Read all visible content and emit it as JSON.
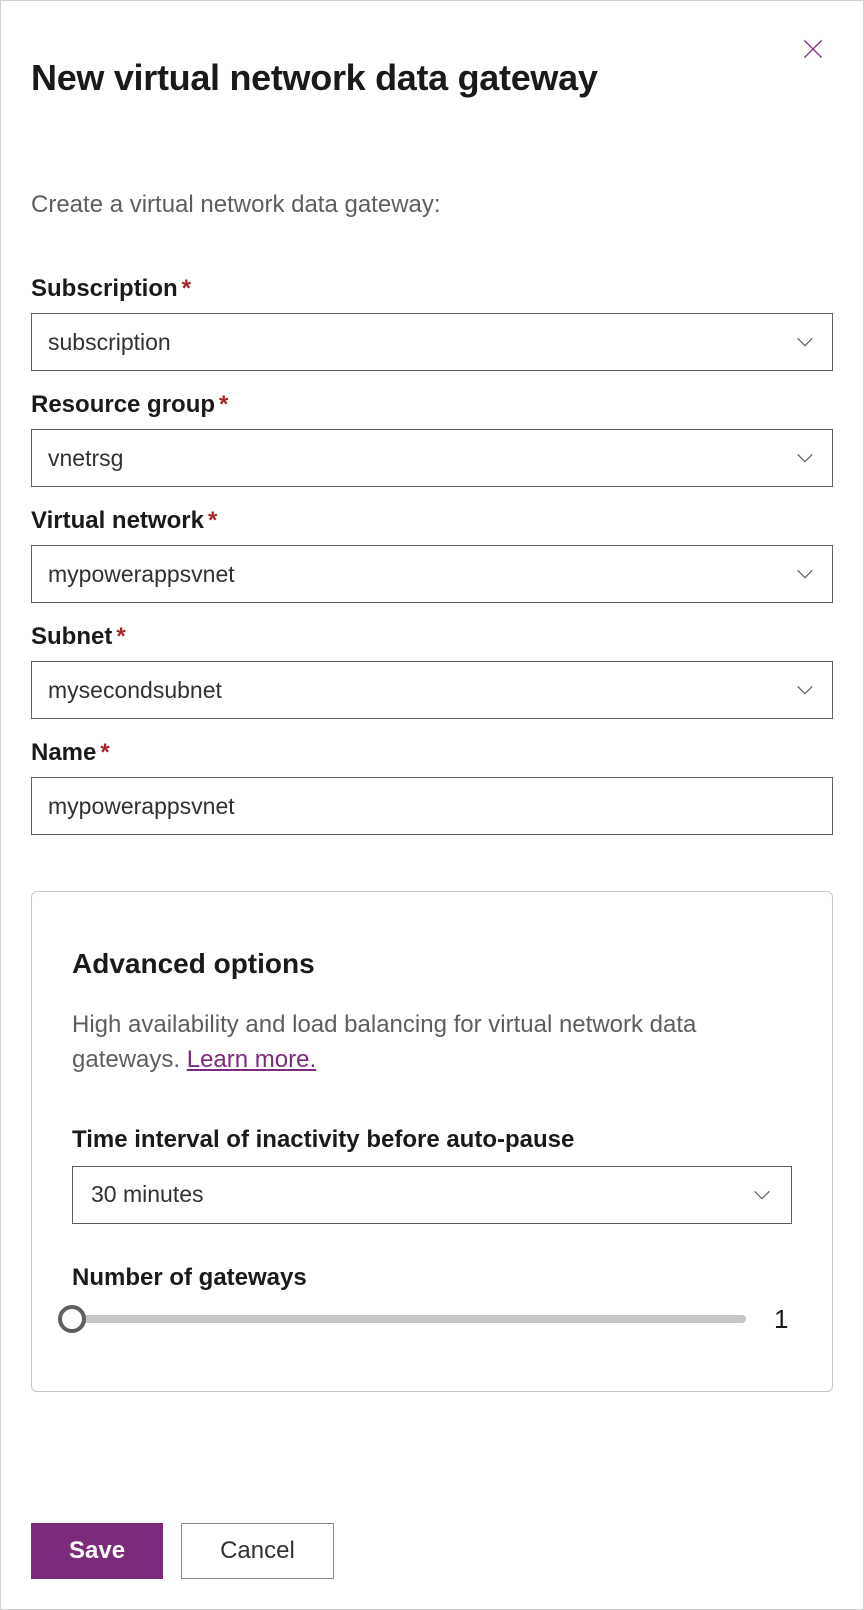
{
  "header": {
    "title": "New virtual network data gateway"
  },
  "subtitle": "Create a virtual network data gateway:",
  "fields": {
    "subscription": {
      "label": "Subscription",
      "value": "subscription"
    },
    "resource_group": {
      "label": "Resource group",
      "value": "vnetrsg"
    },
    "virtual_network": {
      "label": "Virtual network",
      "value": "mypowerappsvnet"
    },
    "subnet": {
      "label": "Subnet",
      "value": "mysecondsubnet"
    },
    "name": {
      "label": "Name",
      "value": "mypowerappsvnet"
    }
  },
  "advanced": {
    "title": "Advanced options",
    "description": "High availability and load balancing for virtual network data gateways. ",
    "learn_more": "Learn more.",
    "inactivity": {
      "label": "Time interval of inactivity before auto-pause",
      "value": "30 minutes"
    },
    "gateways": {
      "label": "Number of gateways",
      "value": "1"
    }
  },
  "footer": {
    "save": "Save",
    "cancel": "Cancel"
  }
}
